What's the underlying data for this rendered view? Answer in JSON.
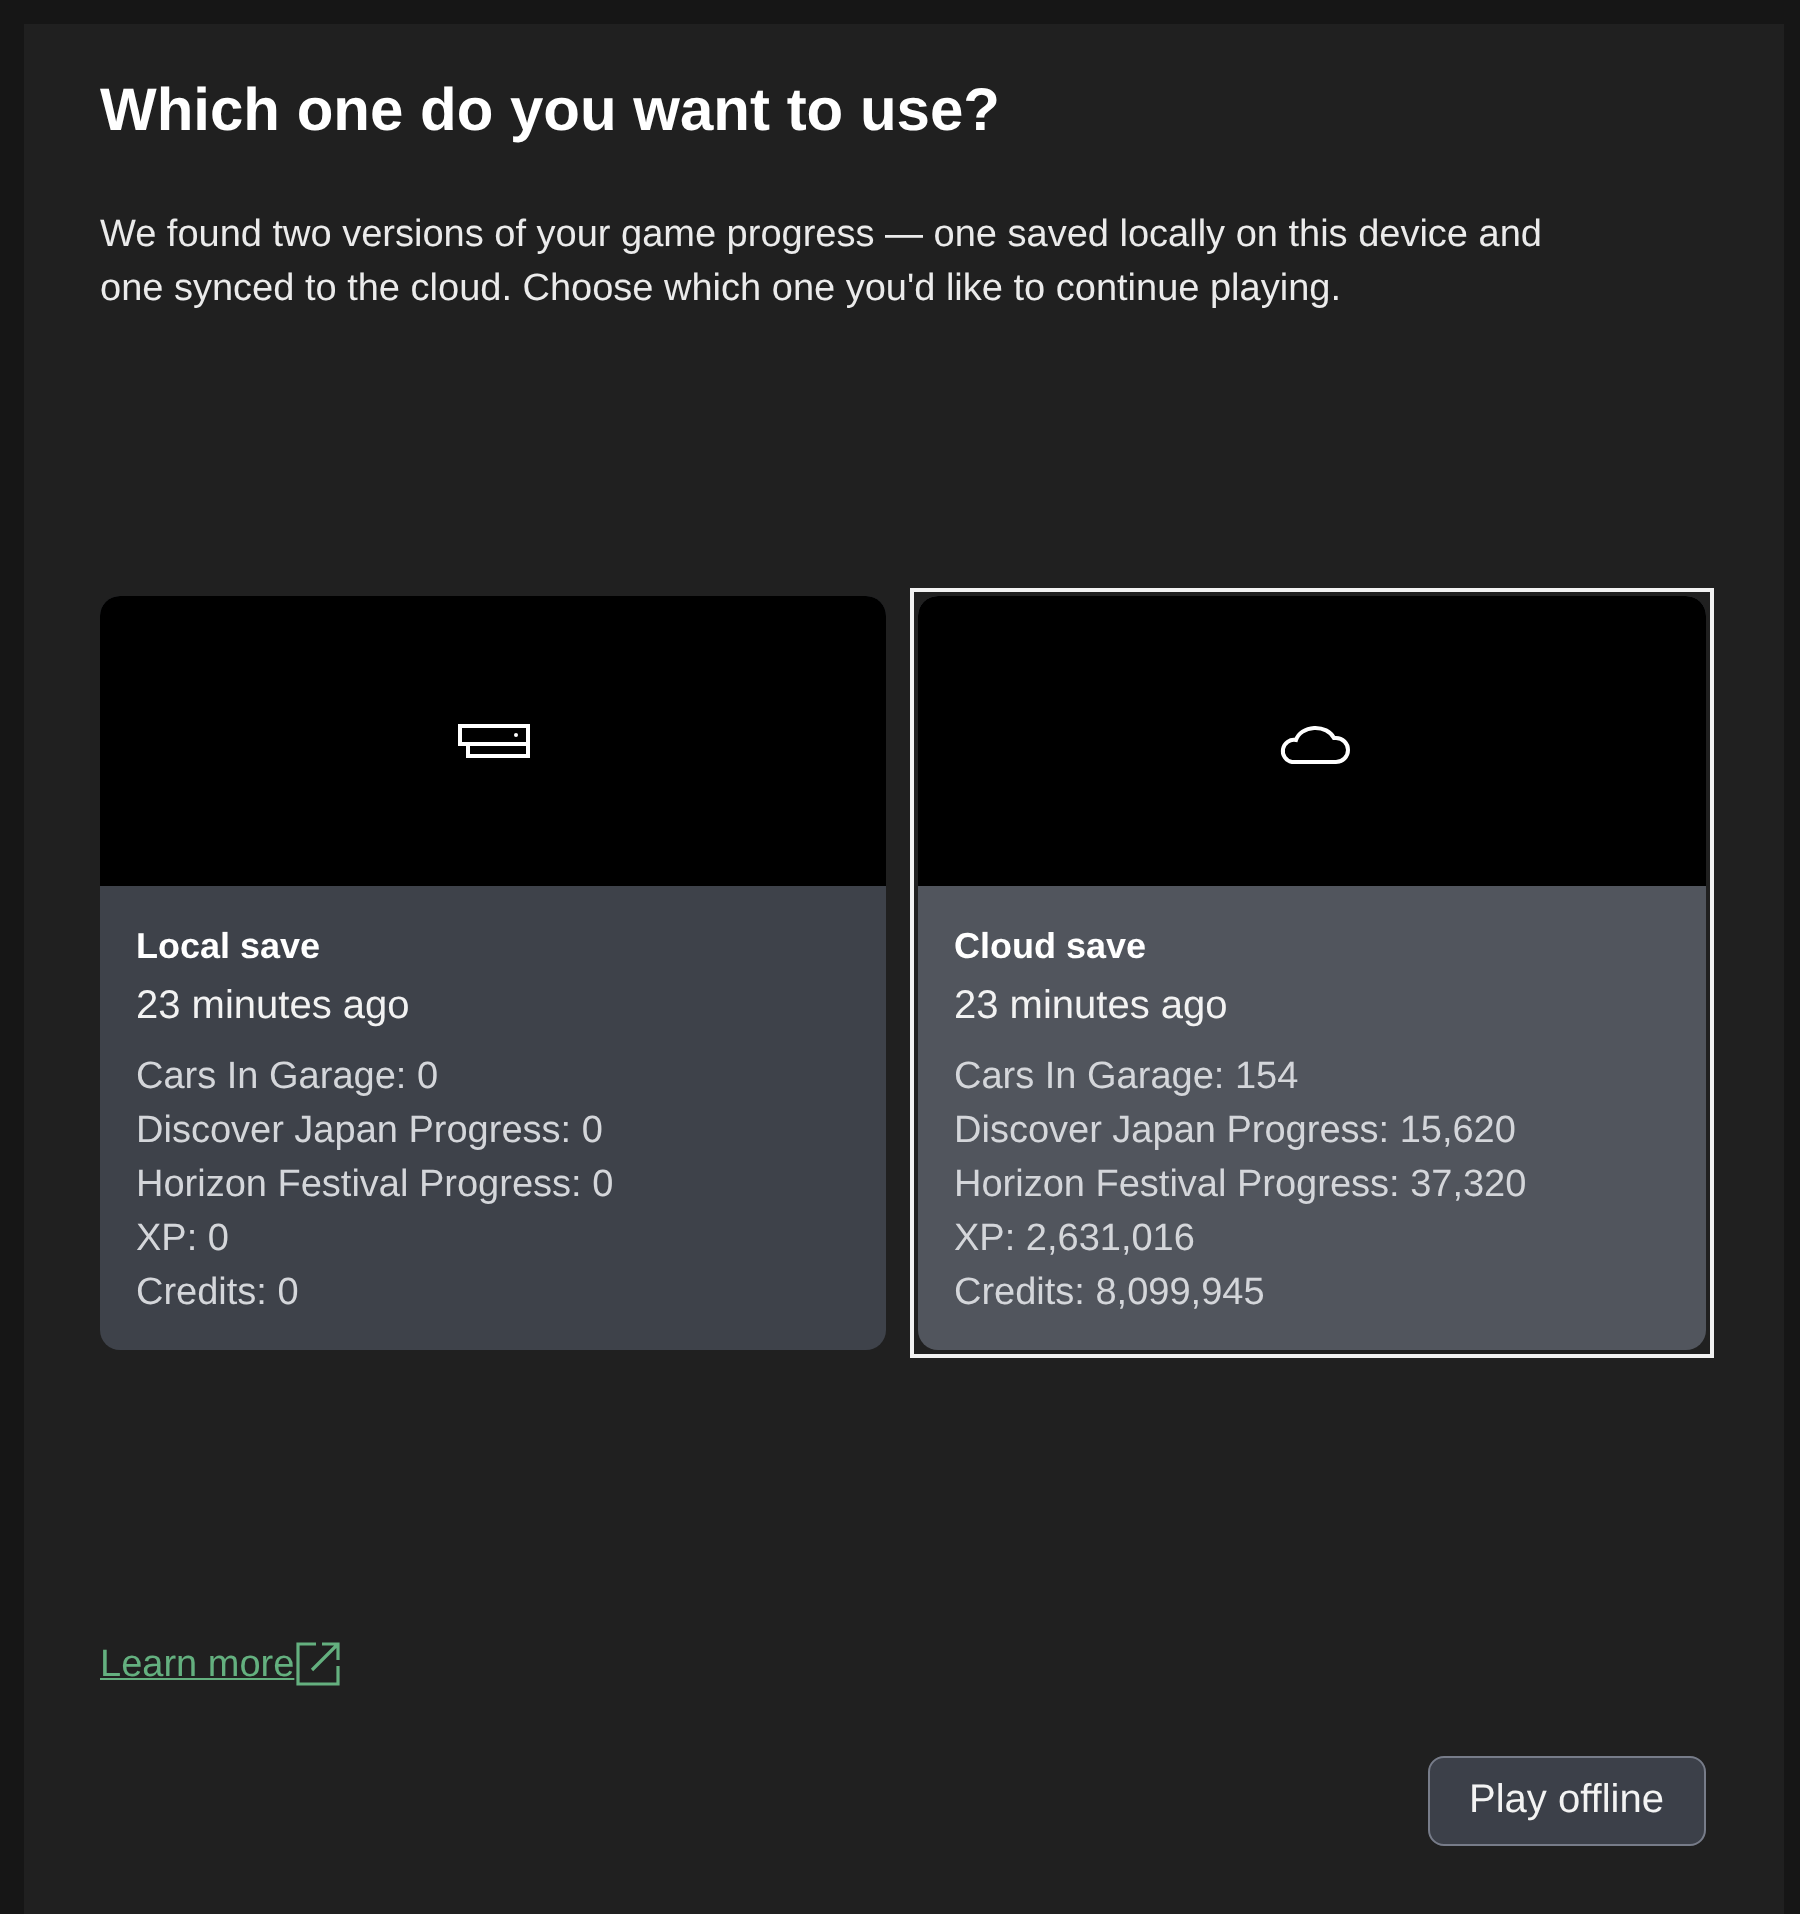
{
  "dialog": {
    "title": "Which one do you want to use?",
    "description": "We found two versions of your game progress — one saved locally on this device and one synced to the cloud. Choose which one you'd like to continue playing."
  },
  "saves": [
    {
      "kind": "local",
      "title": "Local save",
      "time": "23 minutes ago",
      "stats": [
        "Cars In Garage: 0",
        "Discover Japan Progress: 0",
        "Horizon Festival Progress: 0",
        "XP: 0",
        "Credits: 0"
      ],
      "selected": false
    },
    {
      "kind": "cloud",
      "title": "Cloud save",
      "time": "23 minutes ago",
      "stats": [
        "Cars In Garage: 154",
        "Discover Japan Progress: 15,620",
        "Horizon Festival Progress: 37,320",
        "XP: 2,631,016",
        "Credits: 8,099,945"
      ],
      "selected": true
    }
  ],
  "learn_more_link": {
    "label": "Learn more"
  },
  "buttons": [
    {
      "label": "Play offline"
    }
  ]
}
